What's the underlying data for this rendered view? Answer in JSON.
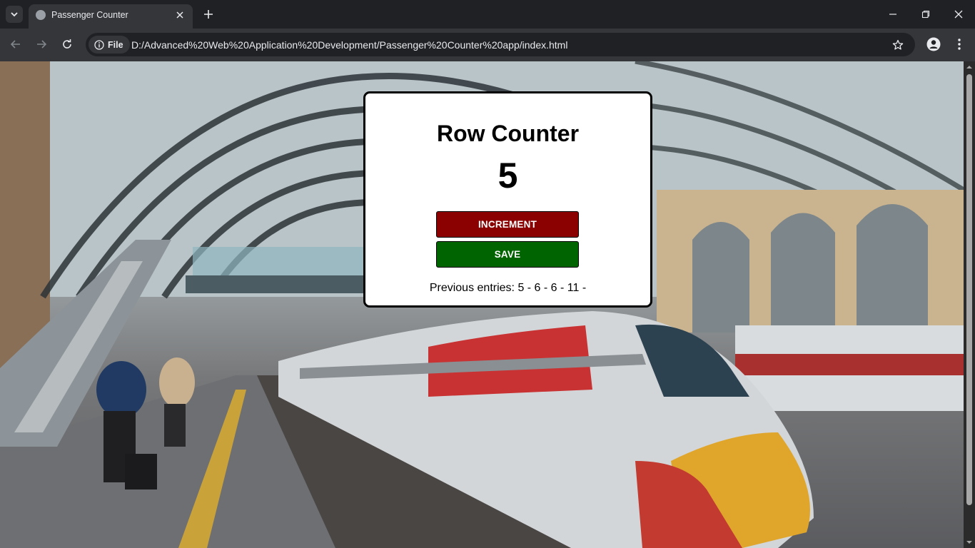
{
  "browser": {
    "tab_title": "Passenger Counter",
    "file_label": "File",
    "url": "D:/Advanced%20Web%20Application%20Development/Passenger%20Counter%20app/index.html"
  },
  "app": {
    "title": "Row Counter",
    "count": "5",
    "increment_label": "INCREMENT",
    "save_label": "SAVE",
    "entries_text": "Previous entries: 5 - 6 - 6 - 11 -"
  },
  "colors": {
    "increment_button": "#8b0000",
    "save_button": "#006400",
    "card_background": "#ffffff",
    "browser_chrome": "#35363a"
  },
  "icons": [
    "chevron-down-icon",
    "globe-icon",
    "close-icon",
    "plus-icon",
    "minimize-icon",
    "restore-icon",
    "window-close-icon",
    "back-icon",
    "forward-icon",
    "reload-icon",
    "info-icon",
    "star-icon",
    "profile-icon",
    "kebab-menu-icon"
  ]
}
